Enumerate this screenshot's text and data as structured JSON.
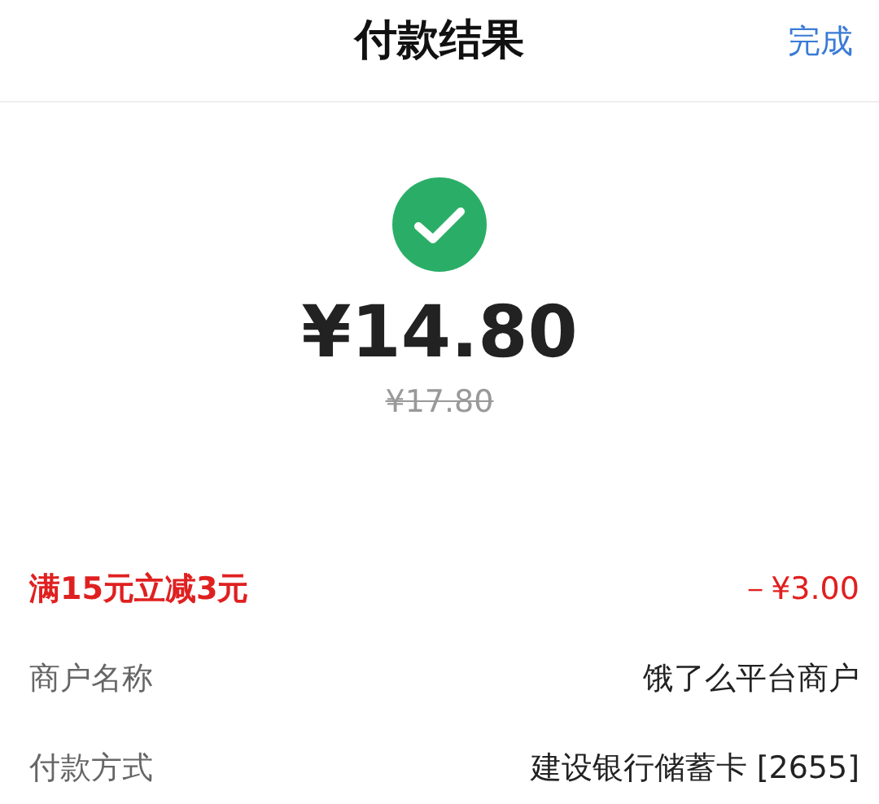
{
  "header": {
    "title": "付款结果",
    "done_button": "完成"
  },
  "result": {
    "success": true,
    "amount": "¥14.80",
    "original_amount": "¥17.80"
  },
  "details": [
    {
      "kind": "discount",
      "label": "满15元立减3元",
      "value": "－¥3.00"
    },
    {
      "kind": "info",
      "label": "商户名称",
      "value": "饿了么平台商户"
    },
    {
      "kind": "info",
      "label": "付款方式",
      "value": "建设银行储蓄卡 [2655]"
    }
  ]
}
